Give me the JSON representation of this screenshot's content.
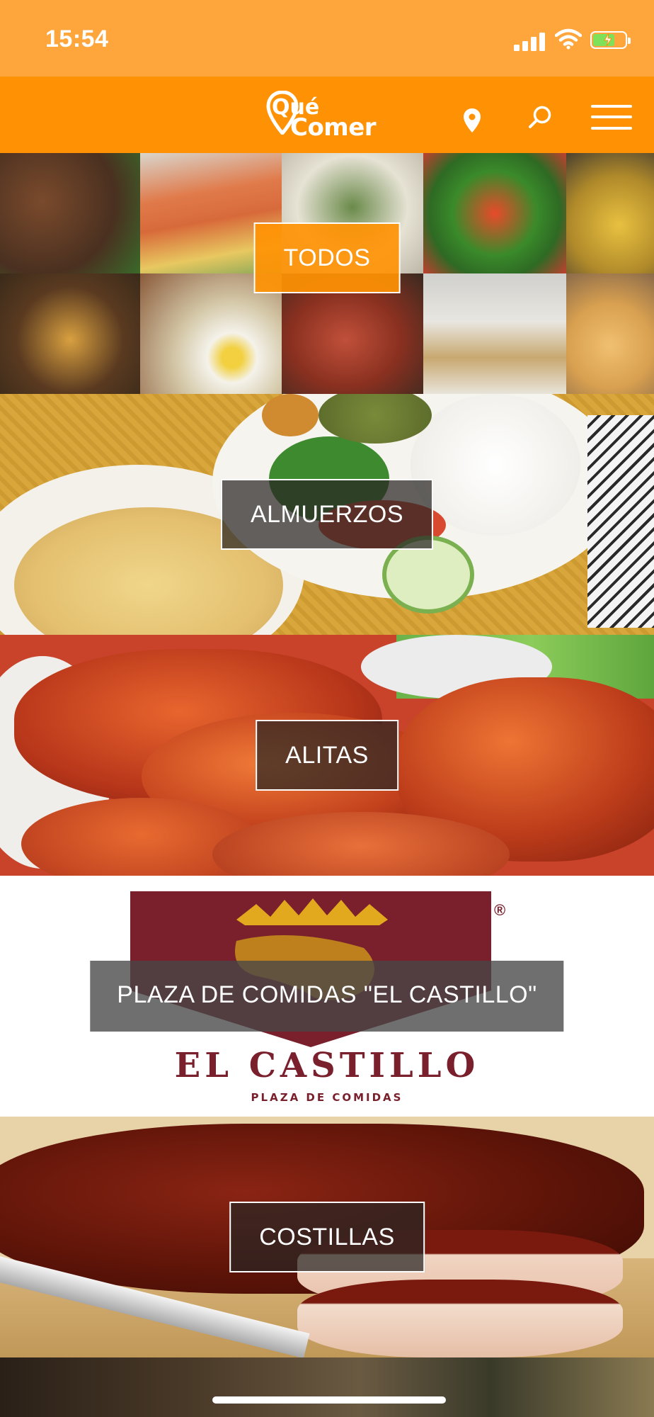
{
  "status_bar": {
    "time": "15:54"
  },
  "header": {
    "logo_line1": "Qué",
    "logo_line2": "Comer",
    "icons": [
      "location-pin-icon",
      "search-icon",
      "hamburger-menu-icon"
    ],
    "brand_color": "#ff9204"
  },
  "categories": [
    {
      "label": "TODOS"
    },
    {
      "label": "ALMUERZOS"
    },
    {
      "label": "ALITAS"
    },
    {
      "label": "PLAZA DE COMIDAS \"EL CASTILLO\""
    },
    {
      "label": "COSTILLAS"
    }
  ],
  "castillo_logo": {
    "name": "EL CASTILLO",
    "tagline": "PLAZA DE COMIDAS",
    "mark": "®"
  }
}
